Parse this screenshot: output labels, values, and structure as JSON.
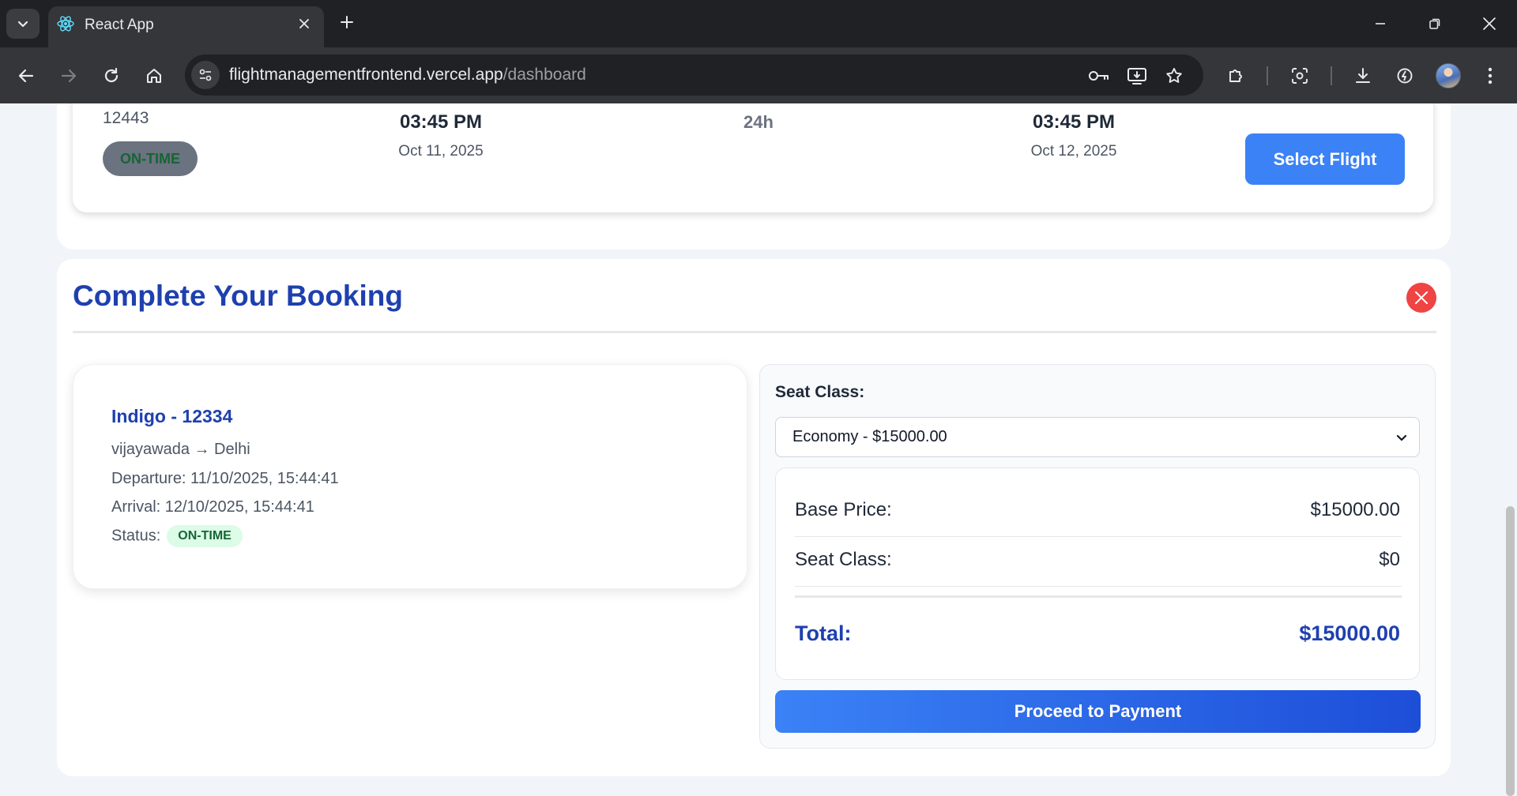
{
  "browser": {
    "tab_title": "React App",
    "url_host": "flightmanagementfrontend.vercel.app",
    "url_path": "/dashboard"
  },
  "flight_result": {
    "flight_number": "12443",
    "status": "ON-TIME",
    "departure_time": "03:45 PM",
    "departure_date": "Oct 11, 2025",
    "duration": "24h",
    "arrival_time": "03:45 PM",
    "arrival_date": "Oct 12, 2025",
    "select_label": "Select Flight"
  },
  "booking": {
    "title": "Complete Your Booking",
    "summary": {
      "title": "Indigo - 12334",
      "route": "vijayawada → Delhi",
      "departure": "Departure: 11/10/2025, 15:44:41",
      "arrival": "Arrival: 12/10/2025, 15:44:41",
      "status_label": "Status:",
      "status": "ON-TIME"
    },
    "seat_class_label": "Seat Class:",
    "seat_class_selected": "Economy - $15000.00",
    "price": {
      "base_label": "Base Price:",
      "base_value": "$15000.00",
      "seat_label": "Seat Class:",
      "seat_value": "$0",
      "total_label": "Total:",
      "total_value": "$15000.00"
    },
    "pay_label": "Proceed to Payment"
  },
  "colors": {
    "accent": "#3b82f6",
    "heading": "#1e40af",
    "danger": "#ef4444",
    "success_bg": "#dcfce7",
    "success_text": "#166534"
  }
}
